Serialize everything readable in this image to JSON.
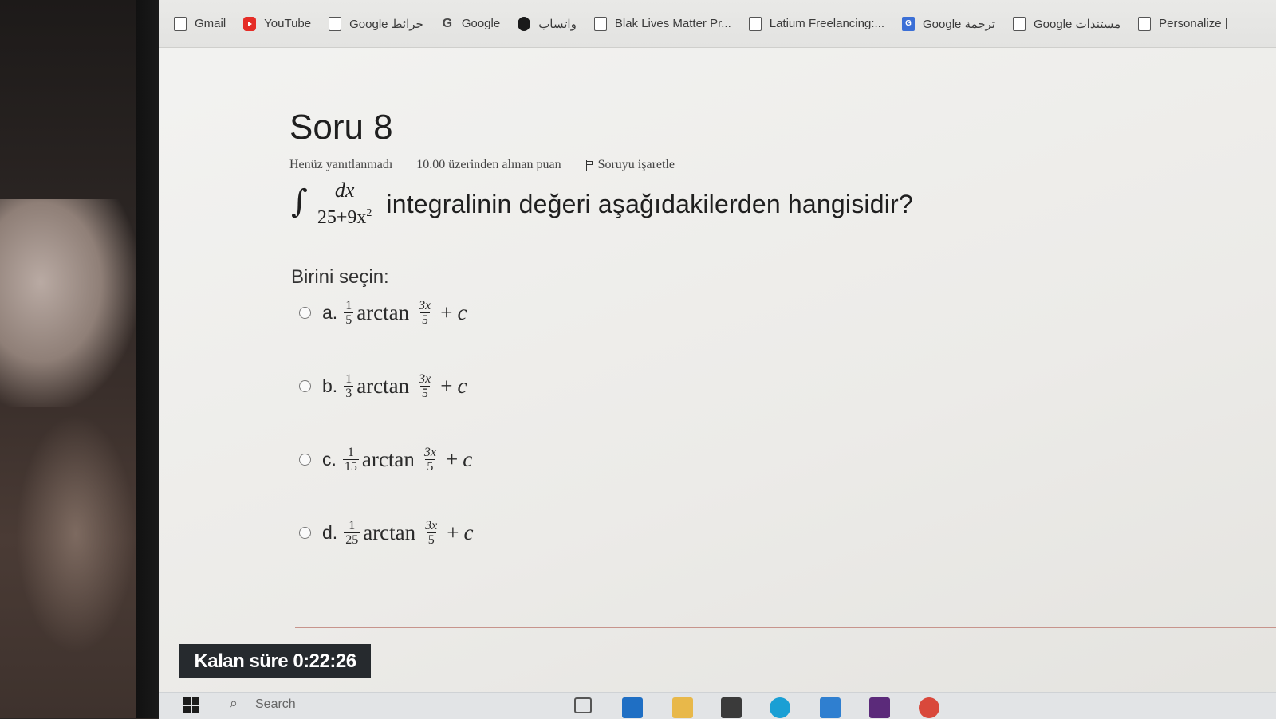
{
  "bookmarks": [
    {
      "label": "Gmail",
      "icon": "page-icon"
    },
    {
      "label": "YouTube",
      "icon": "youtube-icon"
    },
    {
      "label": "Google خرائط",
      "icon": "page-icon"
    },
    {
      "label": "Google",
      "icon": "google-icon"
    },
    {
      "label": "واتساب",
      "icon": "whatsapp-icon"
    },
    {
      "label": "Blak Lives Matter Pr...",
      "icon": "page-icon"
    },
    {
      "label": "Latium Freelancing:...",
      "icon": "page-icon"
    },
    {
      "label": "Google ترجمة",
      "icon": "translate-icon"
    },
    {
      "label": "Google مستندات",
      "icon": "page-icon"
    },
    {
      "label": "Personalize |",
      "icon": "page-icon"
    }
  ],
  "question": {
    "title": "Soru 8",
    "status": "Henüz yanıtlanmadı",
    "points": "10.00 üzerinden alınan puan",
    "flag_label": "Soruyu işaretle",
    "integral_sign": "∫",
    "integrand_num": "dx",
    "integrand_den_base": "25+9x",
    "integrand_den_exp": "2",
    "text": "integralinin değeri aşağıdakilerden hangisidir?",
    "choose_label": "Birini seçin:"
  },
  "options": [
    {
      "letter": "a.",
      "coef_num": "1",
      "coef_den": "5",
      "fn": "arctan",
      "arg_num": "3x",
      "arg_den": "5",
      "plus": "+",
      "const": "c"
    },
    {
      "letter": "b.",
      "coef_num": "1",
      "coef_den": "3",
      "fn": "arctan",
      "arg_num": "3x",
      "arg_den": "5",
      "plus": "+",
      "const": "c"
    },
    {
      "letter": "c.",
      "coef_num": "1",
      "coef_den": "15",
      "fn": "arctan",
      "arg_num": "3x",
      "arg_den": "5",
      "plus": "+",
      "const": "c"
    },
    {
      "letter": "d.",
      "coef_num": "1",
      "coef_den": "25",
      "fn": "arctan",
      "arg_num": "3x",
      "arg_den": "5",
      "plus": "+",
      "const": "c"
    }
  ],
  "timer": {
    "label": "Kalan süre 0:22:26"
  },
  "taskbar": {
    "search_placeholder": "Search"
  }
}
